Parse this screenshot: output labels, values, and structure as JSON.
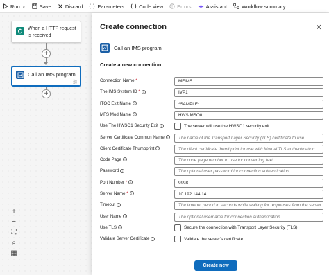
{
  "toolbar": {
    "items": [
      {
        "label": "Run",
        "icon": "play-icon",
        "has_dropdown": true
      },
      {
        "label": "Save",
        "icon": "save-icon"
      },
      {
        "label": "Discard",
        "icon": "close-icon"
      },
      {
        "label": "Parameters",
        "icon": "parameters-icon"
      },
      {
        "label": "Code view",
        "icon": "code-icon"
      },
      {
        "label": "Errors",
        "icon": "error-icon",
        "disabled": true
      },
      {
        "label": "Assistant",
        "icon": "assistant-icon"
      },
      {
        "label": "Workflow summary",
        "icon": "workflow-summary-icon"
      }
    ]
  },
  "canvas": {
    "trigger_card": {
      "label": "When a HTTP request is received",
      "icon": "http-trigger-icon"
    },
    "action_card": {
      "label": "Call an IMS program",
      "icon": "ims-program-icon",
      "link_icon": "link-icon"
    },
    "zoom_controls": [
      {
        "name": "zoom-in-icon",
        "glyph": "+"
      },
      {
        "name": "zoom-out-icon",
        "glyph": "−"
      },
      {
        "name": "fit-view-icon",
        "glyph": "⛶"
      },
      {
        "name": "search-icon",
        "glyph": "⌕"
      },
      {
        "name": "minimap-icon",
        "glyph": "▦"
      }
    ]
  },
  "panel": {
    "title": "Create connection",
    "close_glyph": "✕",
    "connector_name": "Call an IMS program",
    "section_title": "Create a new connection",
    "fields": [
      {
        "label": "Connection Name",
        "required": true,
        "info": false,
        "type": "input",
        "value": "MFIMS"
      },
      {
        "label": "The IMS System ID",
        "required": true,
        "info": true,
        "type": "input",
        "value": "IVP1"
      },
      {
        "label": "ITOC Exit Name",
        "required": false,
        "info": true,
        "type": "input",
        "value": "*SAMPLE*"
      },
      {
        "label": "MFS Mod Name",
        "required": false,
        "info": true,
        "type": "input",
        "value": "HWSIMSO0"
      },
      {
        "label": "Use The HWSO1 Security Exit",
        "required": false,
        "info": true,
        "type": "checkbox",
        "value": "The server will use the HWSO1 security exit."
      },
      {
        "label": "Server Certificate Common Name",
        "required": false,
        "info": true,
        "type": "input",
        "placeholder": "The name of the Transport Layer Security (TLS) certificate to use."
      },
      {
        "label": "Client Certificate Thumbprint",
        "required": false,
        "info": true,
        "type": "input",
        "placeholder": "The client certificate thumbprint for use with Mutual TLS authentication"
      },
      {
        "label": "Code Page",
        "required": false,
        "info": true,
        "type": "input",
        "placeholder": "The code page number to use for converting text."
      },
      {
        "label": "Password",
        "required": false,
        "info": true,
        "type": "input",
        "placeholder": "The optional user password for connection authentication."
      },
      {
        "label": "Port Number",
        "required": true,
        "info": true,
        "type": "input",
        "value": "9998"
      },
      {
        "label": "Server Name",
        "required": true,
        "info": true,
        "type": "input",
        "value": "10.192.144.14"
      },
      {
        "label": "Timeout",
        "required": false,
        "info": true,
        "type": "input",
        "placeholder": "The timeout period in seconds while waiting for responses from the server."
      },
      {
        "label": "User Name",
        "required": false,
        "info": true,
        "type": "input",
        "placeholder": "The optional username for connection authentication."
      },
      {
        "label": "Use TLS",
        "required": false,
        "info": true,
        "type": "checkbox",
        "value": "Secure the connection with Transport Layer Security (TLS)."
      },
      {
        "label": "Validate Server Certificate",
        "required": false,
        "info": true,
        "type": "checkbox",
        "value": "Validate the server's certificate."
      }
    ],
    "create_button": "Create new"
  }
}
